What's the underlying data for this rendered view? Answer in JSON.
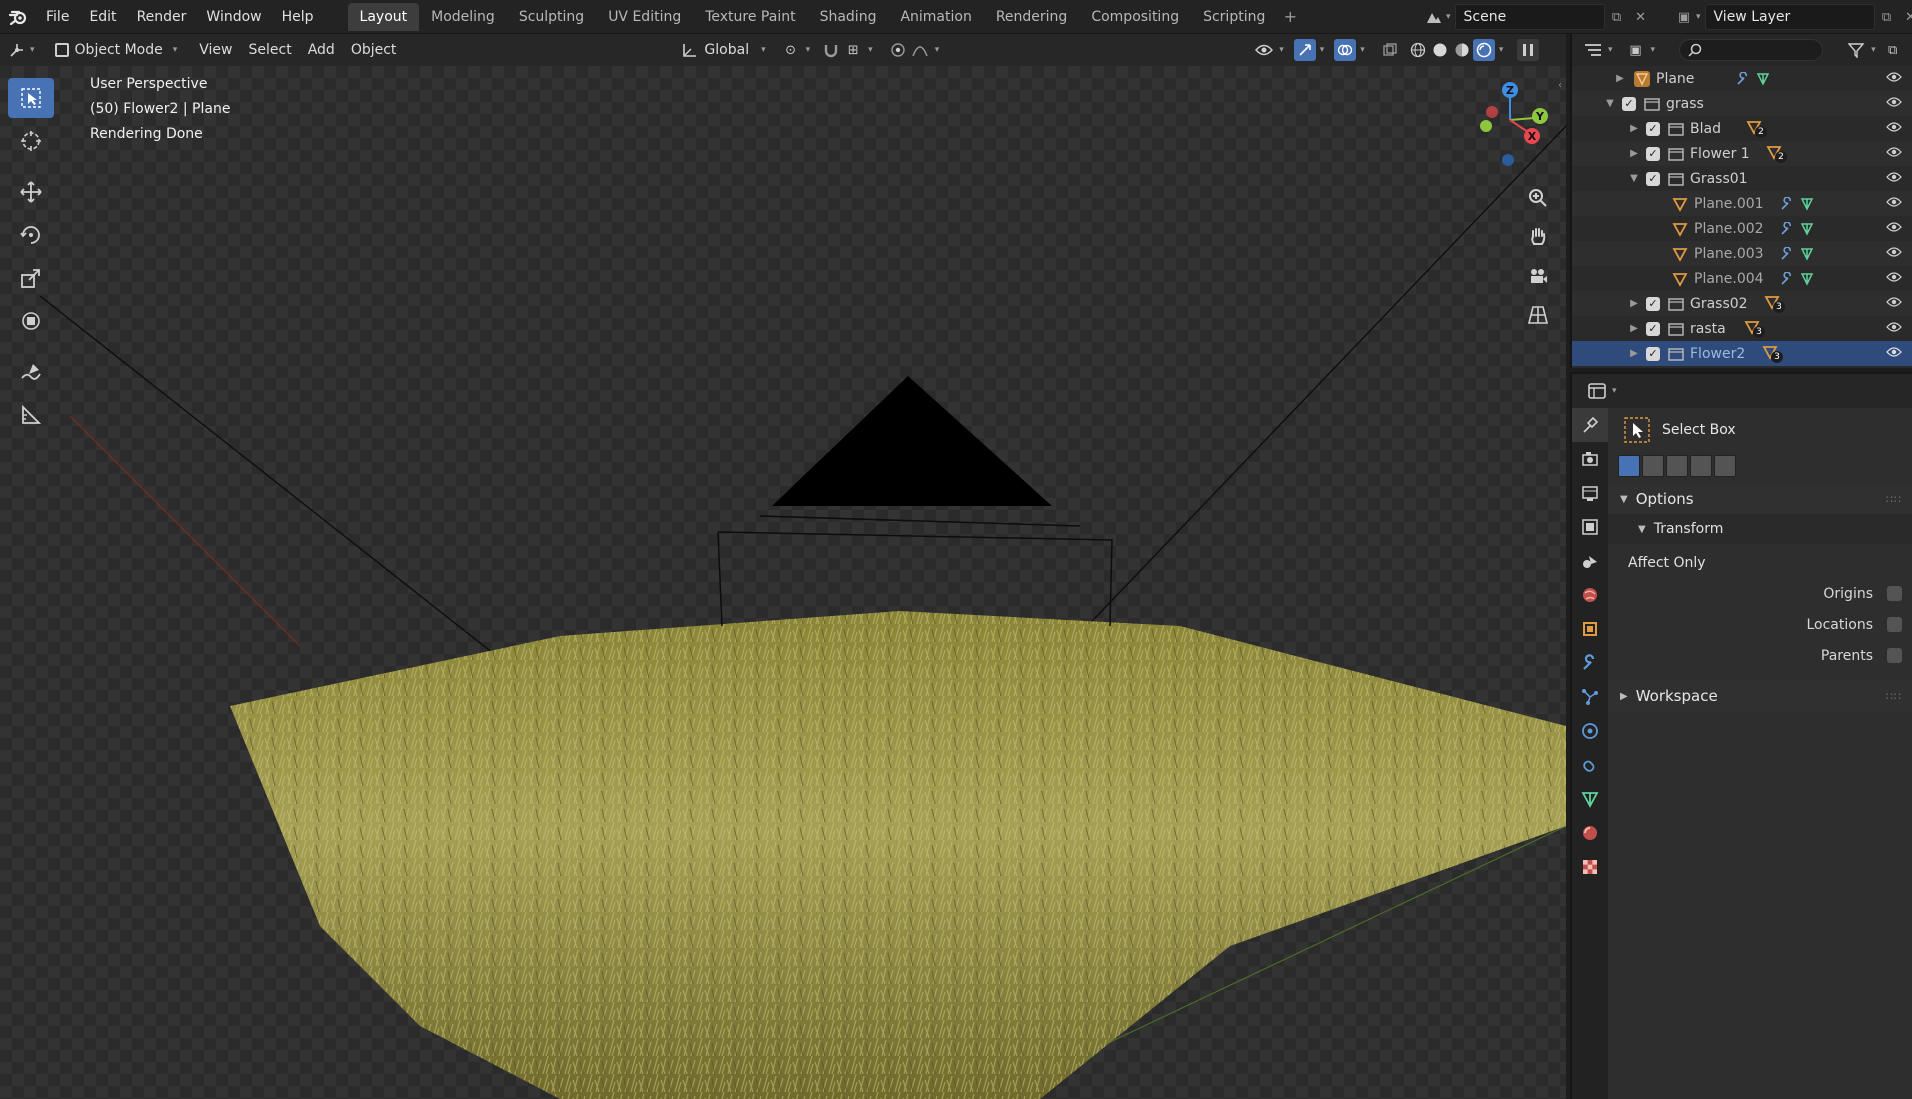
{
  "menus": [
    "File",
    "Edit",
    "Render",
    "Window",
    "Help"
  ],
  "workspaces": [
    "Layout",
    "Modeling",
    "Sculpting",
    "UV Editing",
    "Texture Paint",
    "Shading",
    "Animation",
    "Rendering",
    "Compositing",
    "Scripting"
  ],
  "scene": "Scene",
  "view_layer": "View Layer",
  "viewport_header": {
    "mode": "Object Mode",
    "menus": [
      "View",
      "Select",
      "Add",
      "Object"
    ],
    "orientation": "Global"
  },
  "overlay": {
    "line1": "User Perspective",
    "line2": "(50) Flower2 | Plane",
    "line3": "Rendering Done"
  },
  "gizmo": {
    "z": "Z",
    "y": "Y",
    "x": "X"
  },
  "outliner": {
    "rows": [
      {
        "label": "Plane",
        "indent": 0,
        "type": "object"
      },
      {
        "label": "grass",
        "indent": 0,
        "type": "collection"
      },
      {
        "label": "Blad",
        "indent": 1,
        "type": "collection",
        "badge": "2"
      },
      {
        "label": "Flower 1",
        "indent": 1,
        "type": "collection",
        "badge": "2"
      },
      {
        "label": "Grass01",
        "indent": 1,
        "type": "collection"
      },
      {
        "label": "Plane.001",
        "indent": 2,
        "type": "object"
      },
      {
        "label": "Plane.002",
        "indent": 2,
        "type": "object"
      },
      {
        "label": "Plane.003",
        "indent": 2,
        "type": "object"
      },
      {
        "label": "Plane.004",
        "indent": 2,
        "type": "object"
      },
      {
        "label": "Grass02",
        "indent": 1,
        "type": "collection",
        "badge": "3"
      },
      {
        "label": "rasta",
        "indent": 1,
        "type": "collection",
        "badge": "3"
      },
      {
        "label": "Flower2",
        "indent": 1,
        "type": "collection",
        "badge": "3",
        "selected": true
      }
    ]
  },
  "properties": {
    "tool_name": "Select Box",
    "options_label": "Options",
    "transform_label": "Transform",
    "affect_only_label": "Affect Only",
    "origins_label": "Origins",
    "locations_label": "Locations",
    "parents_label": "Parents",
    "workspace_label": "Workspace"
  },
  "colors": {
    "accent": "#4772b3",
    "selection": "#2f4b7c",
    "axis_x": "#e8474f",
    "axis_y": "#8ec63f",
    "axis_z": "#3f8ee6"
  }
}
